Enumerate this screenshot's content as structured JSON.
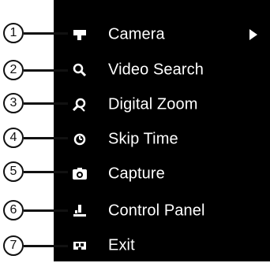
{
  "menu": {
    "items": [
      {
        "number": "1",
        "label": "Camera",
        "icon": "camera-icon",
        "has_submenu": true
      },
      {
        "number": "2",
        "label": "Video Search",
        "icon": "search-icon",
        "has_submenu": false
      },
      {
        "number": "3",
        "label": "Digital Zoom",
        "icon": "zoom-icon",
        "has_submenu": false
      },
      {
        "number": "4",
        "label": "Skip Time",
        "icon": "clock-icon",
        "has_submenu": false
      },
      {
        "number": "5",
        "label": "Capture",
        "icon": "capture-icon",
        "has_submenu": false
      },
      {
        "number": "6",
        "label": "Control Panel",
        "icon": "control-panel-icon",
        "has_submenu": false
      },
      {
        "number": "7",
        "label": "Exit",
        "icon": "exit-icon",
        "has_submenu": false
      }
    ]
  },
  "colors": {
    "menu_bg": "#000000",
    "text": "#ffffff",
    "callout": "#111111"
  }
}
